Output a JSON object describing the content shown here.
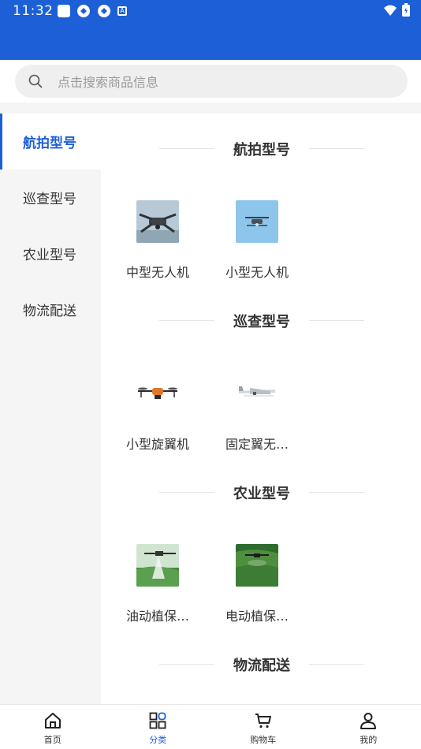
{
  "status_bar": {
    "time": "11:32",
    "accent": "#1d5fd6"
  },
  "search": {
    "placeholder": "点击搜索商品信息"
  },
  "sidebar": {
    "items": [
      {
        "label": "航拍型号",
        "active": true
      },
      {
        "label": "巡查型号",
        "active": false
      },
      {
        "label": "农业型号",
        "active": false
      },
      {
        "label": "物流配送",
        "active": false
      }
    ]
  },
  "sections": [
    {
      "title": "航拍型号",
      "products": [
        {
          "name": "中型无人机",
          "icon": "drone-photo-icon"
        },
        {
          "name": "小型无人机",
          "icon": "drone-sky-icon"
        }
      ]
    },
    {
      "title": "巡查型号",
      "products": [
        {
          "name": "小型旋翼机",
          "icon": "rotor-drone-icon"
        },
        {
          "name": "固定翼无…",
          "icon": "fixed-wing-icon"
        }
      ]
    },
    {
      "title": "农业型号",
      "products": [
        {
          "name": "油动植保…",
          "icon": "spray-drone-icon"
        },
        {
          "name": "电动植保…",
          "icon": "field-drone-icon"
        }
      ]
    },
    {
      "title": "物流配送",
      "products": []
    }
  ],
  "bottom_nav": {
    "items": [
      {
        "label": "首页",
        "icon": "home-icon"
      },
      {
        "label": "分类",
        "icon": "category-icon",
        "active": true
      },
      {
        "label": "购物车",
        "icon": "cart-icon"
      },
      {
        "label": "我的",
        "icon": "profile-icon"
      }
    ]
  }
}
